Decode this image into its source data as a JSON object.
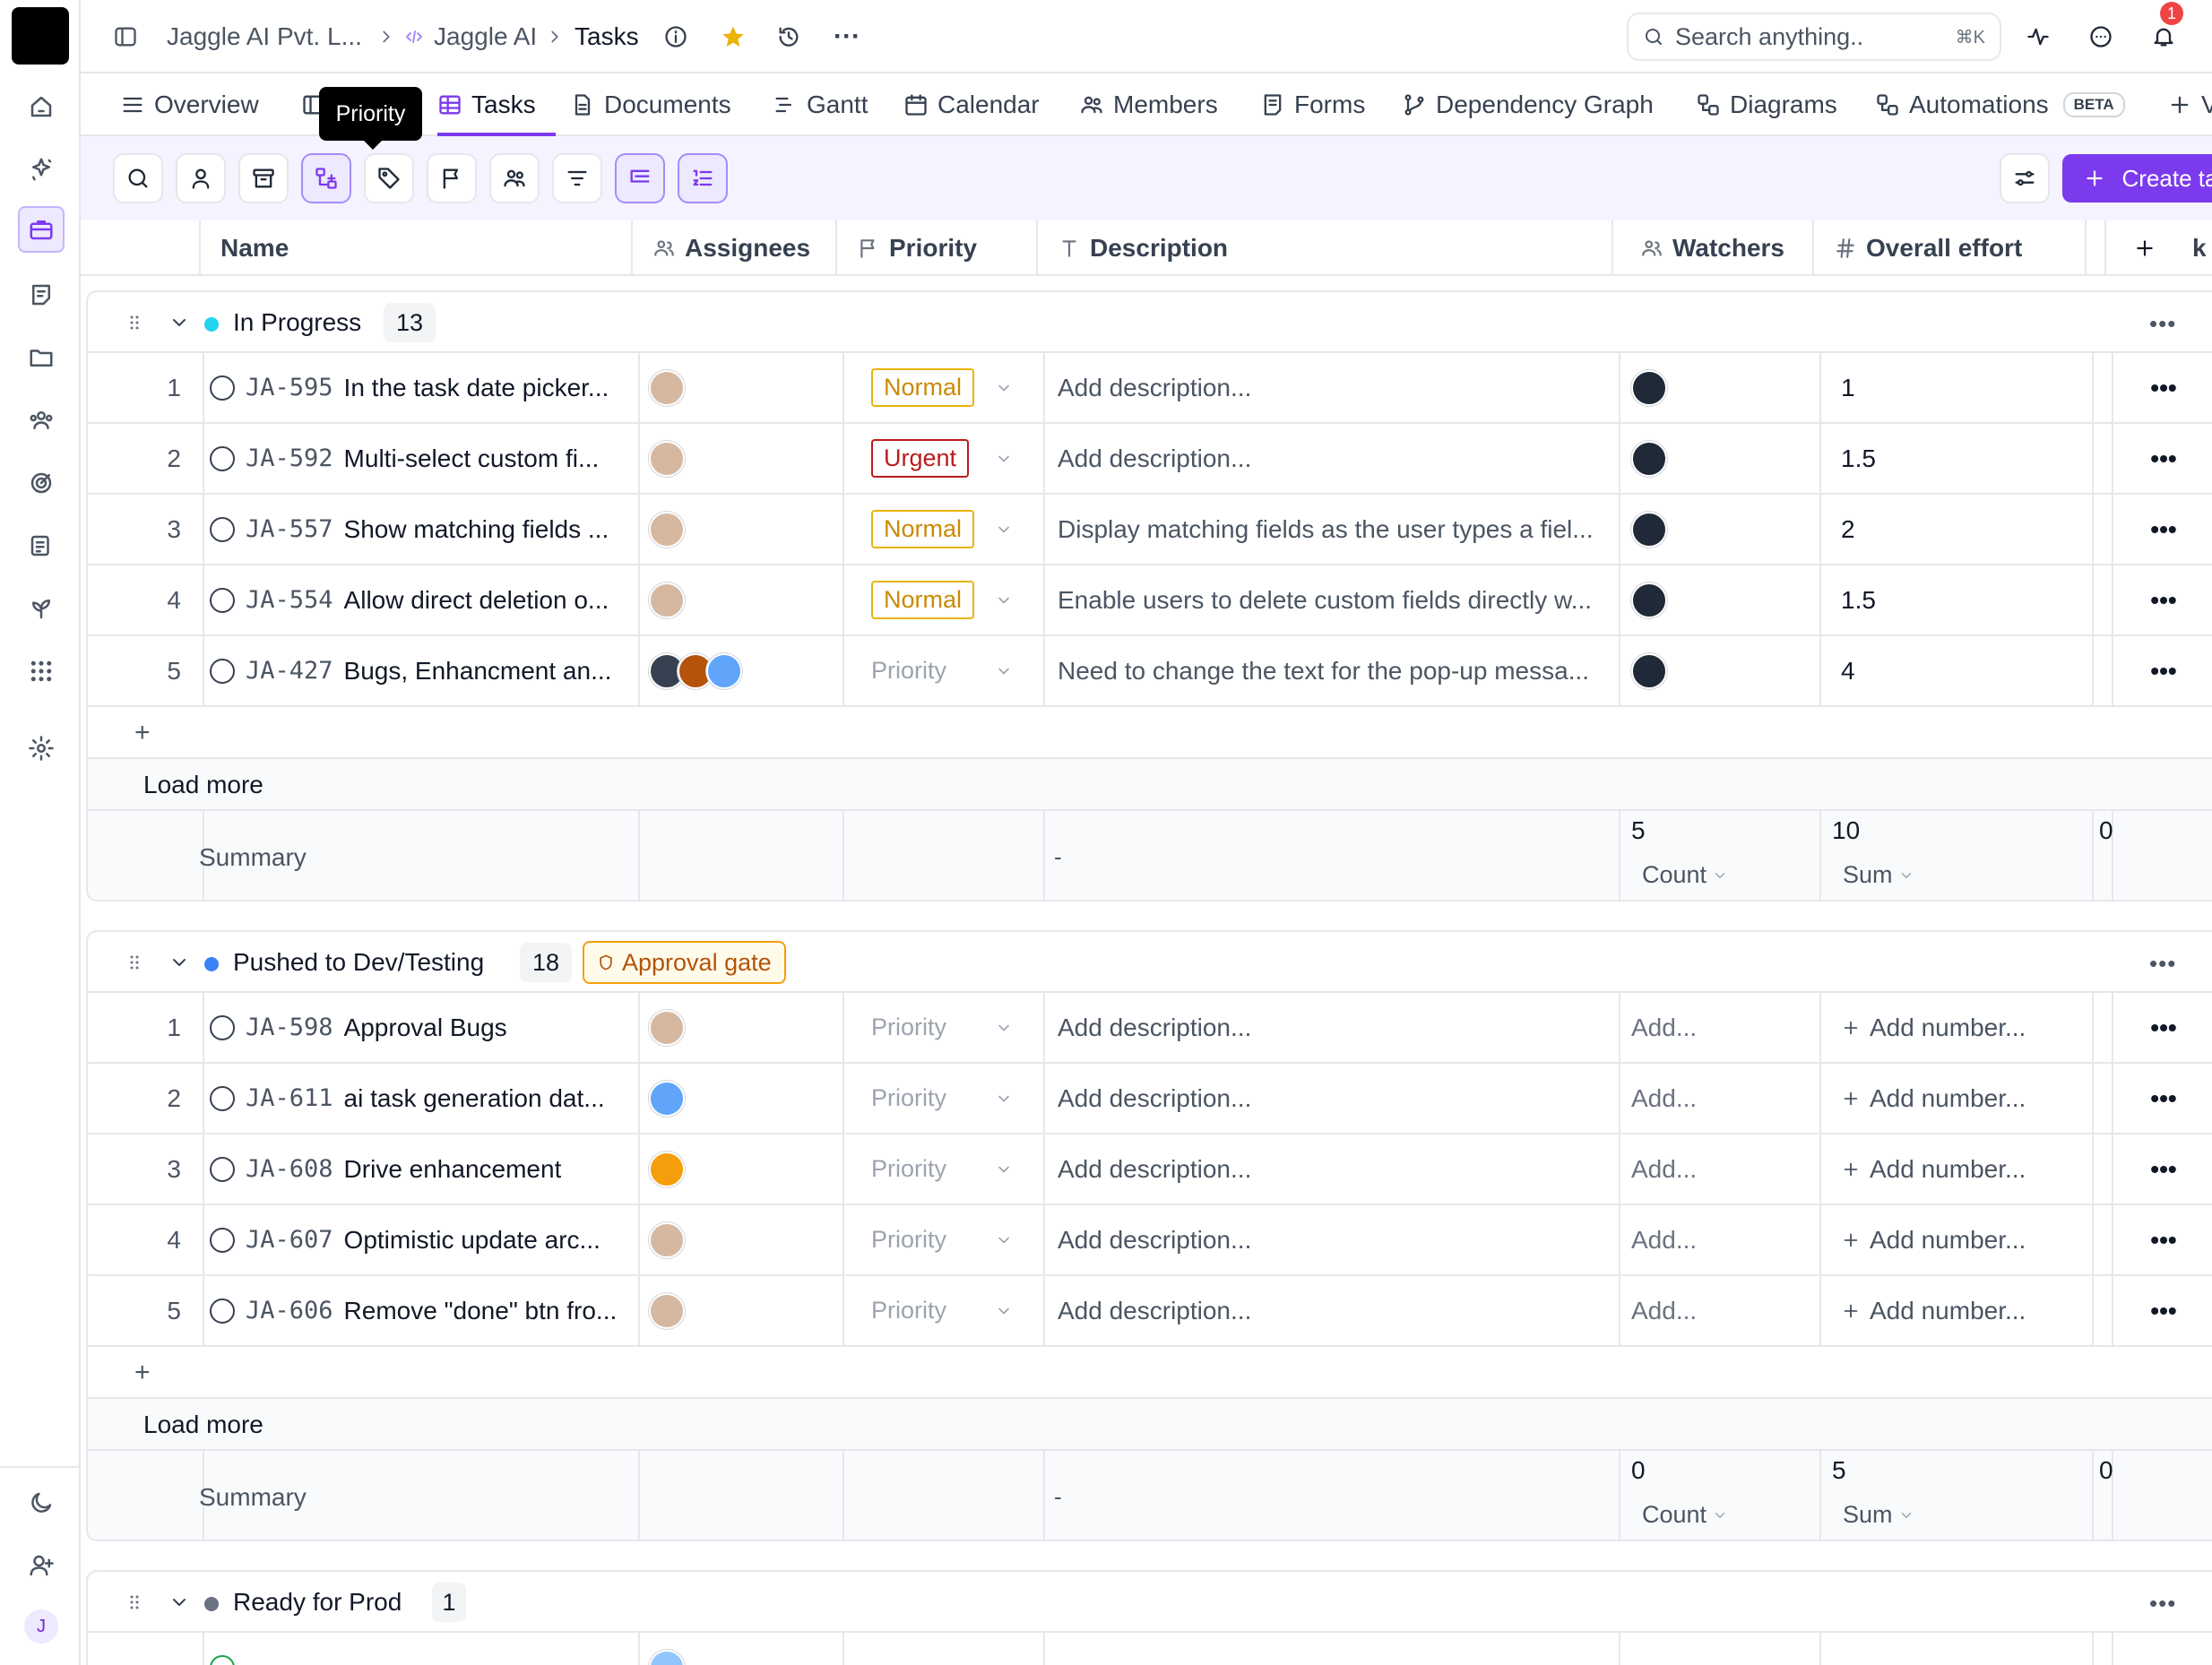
{
  "breadcrumb": {
    "org": "Jaggle AI Pvt. L...",
    "project": "Jaggle AI",
    "page": "Tasks"
  },
  "search": {
    "placeholder": "Search anything..",
    "shortcut": "⌘K"
  },
  "notifications": {
    "count": "1"
  },
  "tabs": [
    {
      "label": "Overview",
      "icon": "list-icon"
    },
    {
      "label": "Tasks",
      "icon": "table-icon",
      "active": true
    },
    {
      "label": "Documents",
      "icon": "document-icon"
    },
    {
      "label": "Gantt",
      "icon": "gantt-icon"
    },
    {
      "label": "Calendar",
      "icon": "calendar-icon"
    },
    {
      "label": "Members",
      "icon": "members-icon"
    },
    {
      "label": "Forms",
      "icon": "forms-icon"
    },
    {
      "label": "Dependency Graph",
      "icon": "graph-icon"
    },
    {
      "label": "Diagrams",
      "icon": "diagram-icon"
    },
    {
      "label": "Automations",
      "icon": "automation-icon",
      "badge": "BETA"
    }
  ],
  "tooltip": "Priority",
  "toolbar": {
    "create_label": "Create task"
  },
  "columns": {
    "name": "Name",
    "assignees": "Assignees",
    "priority": "Priority",
    "description": "Description",
    "watchers": "Watchers",
    "effort": "Overall effort",
    "cut": "k"
  },
  "colors": {
    "accent": "#7c3aed",
    "normal": "#eab308",
    "urgent": "#b91c1c",
    "in_progress_dot": "#22d3ee",
    "pushed_dot": "#3b82f6",
    "ready_dot": "#6b7280"
  },
  "groups": [
    {
      "name": "In Progress",
      "count": "13",
      "rows": [
        {
          "n": "1",
          "key": "JA-595",
          "name": "In the task date picker...",
          "priority": "Normal",
          "desc": "Add description...",
          "effort": "1"
        },
        {
          "n": "2",
          "key": "JA-592",
          "name": "Multi-select custom fi...",
          "priority": "Urgent",
          "desc": "Add description...",
          "effort": "1.5"
        },
        {
          "n": "3",
          "key": "JA-557",
          "name": "Show matching fields ...",
          "priority": "Normal",
          "desc": "Display matching fields as the user types a fiel...",
          "effort": "2"
        },
        {
          "n": "4",
          "key": "JA-554",
          "name": "Allow direct deletion o...",
          "priority": "Normal",
          "desc": "Enable users to delete custom fields directly w...",
          "effort": "1.5"
        },
        {
          "n": "5",
          "key": "JA-427",
          "name": "Bugs, Enhancment an...",
          "priority": "Priority",
          "desc": "Need to change the text for the pop-up messa...",
          "effort": "4"
        }
      ],
      "load_more": "Load more",
      "summary": {
        "label": "Summary",
        "desc": "-",
        "watchers_value": "5",
        "watchers_fn": "Count",
        "effort_value": "10",
        "effort_fn": "Sum",
        "cut": "0"
      }
    },
    {
      "name": "Pushed to Dev/Testing",
      "count": "18",
      "gate": "Approval gate",
      "rows": [
        {
          "n": "1",
          "key": "JA-598",
          "name": "Approval Bugs",
          "priority": "Priority",
          "desc": "Add description...",
          "watchers": "Add...",
          "effort": "Add number..."
        },
        {
          "n": "2",
          "key": "JA-611",
          "name": "ai task generation dat...",
          "priority": "Priority",
          "desc": "Add description...",
          "watchers": "Add...",
          "effort": "Add number..."
        },
        {
          "n": "3",
          "key": "JA-608",
          "name": "Drive enhancement",
          "priority": "Priority",
          "desc": "Add description...",
          "watchers": "Add...",
          "effort": "Add number..."
        },
        {
          "n": "4",
          "key": "JA-607",
          "name": "Optimistic update arc...",
          "priority": "Priority",
          "desc": "Add description...",
          "watchers": "Add...",
          "effort": "Add number..."
        },
        {
          "n": "5",
          "key": "JA-606",
          "name": "Remove \"done\" btn fro...",
          "priority": "Priority",
          "desc": "Add description...",
          "watchers": "Add...",
          "effort": "Add number..."
        }
      ],
      "load_more": "Load more",
      "summary": {
        "label": "Summary",
        "desc": "-",
        "watchers_value": "0",
        "watchers_fn": "Count",
        "effort_value": "5",
        "effort_fn": "Sum",
        "cut": "0"
      }
    },
    {
      "name": "Ready for Prod",
      "count": "1"
    }
  ],
  "user_initial": "J"
}
